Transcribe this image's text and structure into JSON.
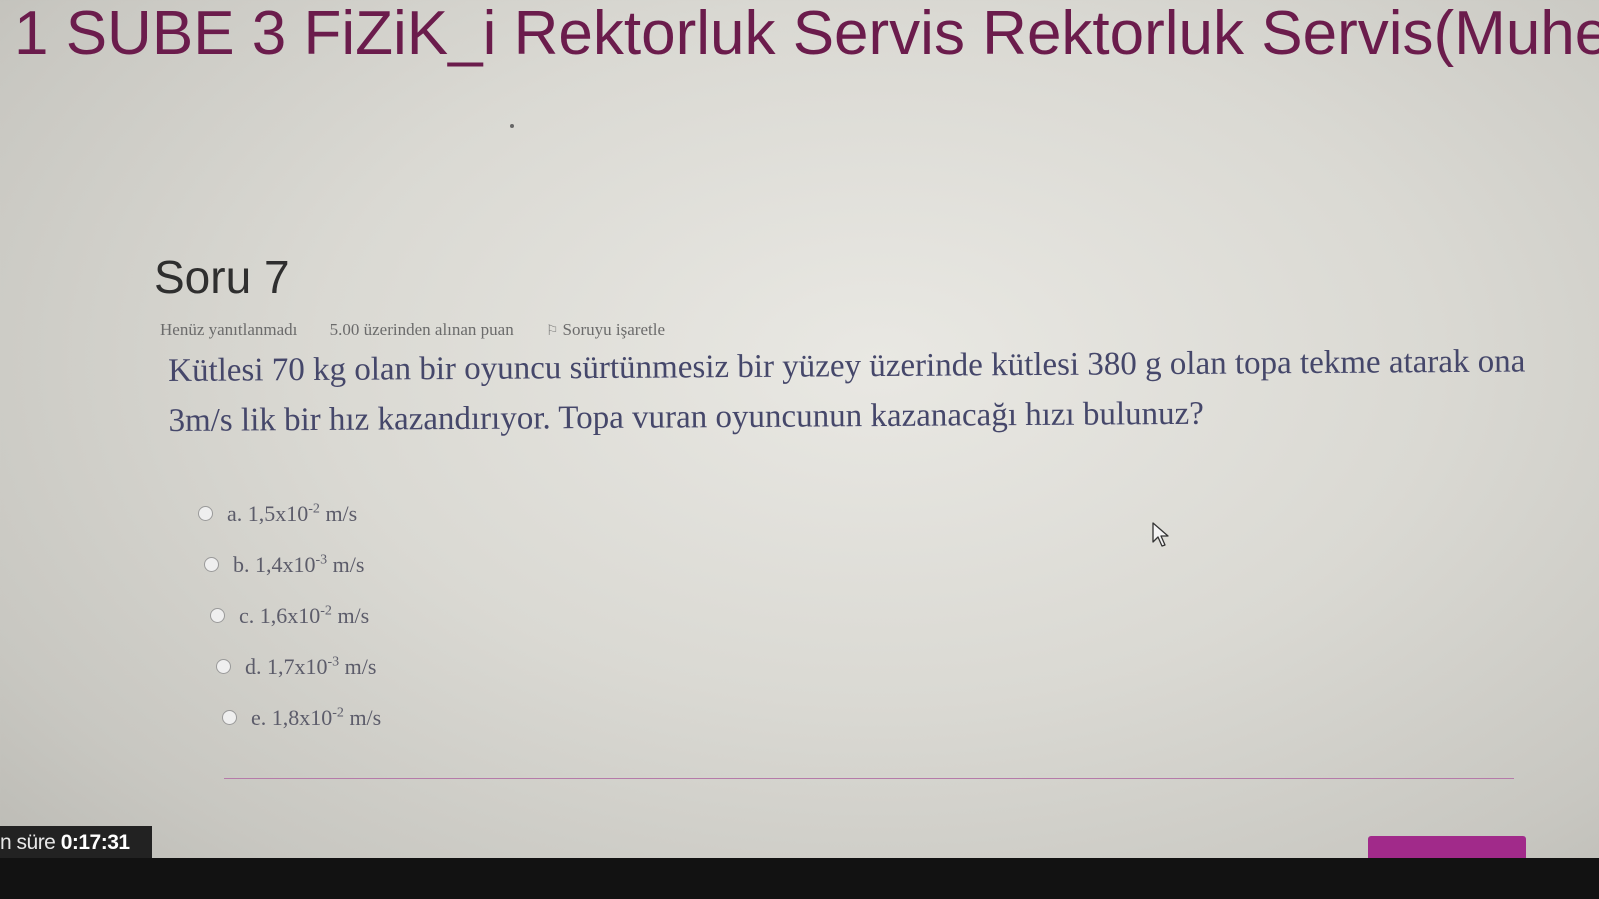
{
  "header": {
    "course_title": "1 SUBE 3 FiZiK_i Rektorluk Servis Rektorluk Servis(Muhe"
  },
  "question": {
    "title": "Soru 7",
    "status": "Henüz yanıtlanmadı",
    "points": "5.00 üzerinden alınan puan",
    "flag_label": "Soruyu işaretle",
    "text": "Kütlesi 70 kg olan bir oyuncu sürtünmesiz bir yüzey üzerinde kütlesi 380 g olan topa tekme atarak ona 3m/s lik bir hız kazandırıyor. Topa vuran oyuncunun kazanacağı hızı bulunuz?"
  },
  "options": [
    {
      "prefix": "a. 1,5x10",
      "exp": "-2",
      "unit": " m/s"
    },
    {
      "prefix": "b. 1,4x10",
      "exp": "-3",
      "unit": " m/s"
    },
    {
      "prefix": "c. 1,6x10",
      "exp": "-2",
      "unit": " m/s"
    },
    {
      "prefix": "d. 1,7x10",
      "exp": "-3",
      "unit": " m/s"
    },
    {
      "prefix": "e. 1,8x10",
      "exp": "-2",
      "unit": " m/s"
    }
  ],
  "timer": {
    "label": "n süre ",
    "value": "0:17:31"
  },
  "colors": {
    "accent": "#a12a8a",
    "title": "#6b1c4c",
    "question_text": "#45476a"
  },
  "icons": {
    "flag": "flag-icon",
    "radio": "radio-icon",
    "cursor": "mouse-cursor-icon"
  }
}
